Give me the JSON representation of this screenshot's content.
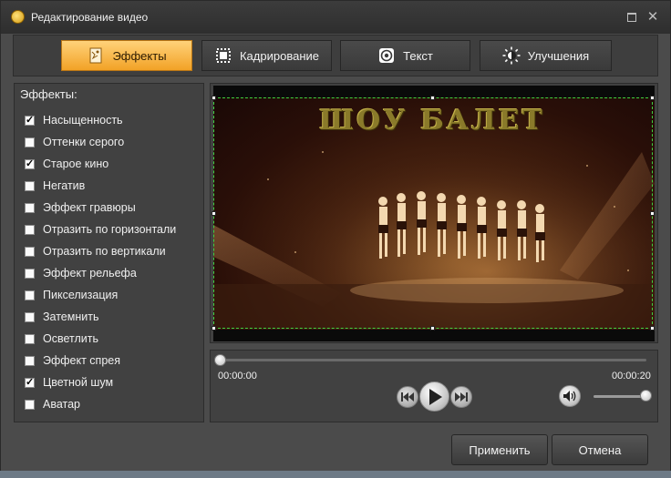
{
  "window": {
    "title": "Редактирование видео"
  },
  "tabs": [
    {
      "label": "Эффекты",
      "icon": "effects-icon",
      "active": true
    },
    {
      "label": "Кадрирование",
      "icon": "crop-icon",
      "active": false
    },
    {
      "label": "Текст",
      "icon": "text-icon",
      "active": false
    },
    {
      "label": "Улучшения",
      "icon": "brightness-icon",
      "active": false
    }
  ],
  "effects": {
    "title": "Эффекты:",
    "items": [
      {
        "label": "Насыщенность",
        "checked": true
      },
      {
        "label": "Оттенки серого",
        "checked": false
      },
      {
        "label": "Старое кино",
        "checked": true
      },
      {
        "label": "Негатив",
        "checked": false
      },
      {
        "label": "Эффект гравюры",
        "checked": false
      },
      {
        "label": "Отразить по горизонтали",
        "checked": false
      },
      {
        "label": "Отразить по вертикали",
        "checked": false
      },
      {
        "label": "Эффект рельефа",
        "checked": false
      },
      {
        "label": "Пикселизация",
        "checked": false
      },
      {
        "label": "Затемнить",
        "checked": false
      },
      {
        "label": "Осветлить",
        "checked": false
      },
      {
        "label": "Эффект спрея",
        "checked": false
      },
      {
        "label": "Цветной шум",
        "checked": true
      },
      {
        "label": "Аватар",
        "checked": false
      }
    ]
  },
  "preview": {
    "overlay_text": "ШОУ БАЛЕТ"
  },
  "player": {
    "time_current": "00:00:00",
    "time_total": "00:00:20",
    "progress": 0.0,
    "volume": 0.95
  },
  "buttons": {
    "apply": "Применить",
    "cancel": "Отмена"
  },
  "colors": {
    "accent": "#f2a226",
    "crop_line": "#3fd23f"
  }
}
